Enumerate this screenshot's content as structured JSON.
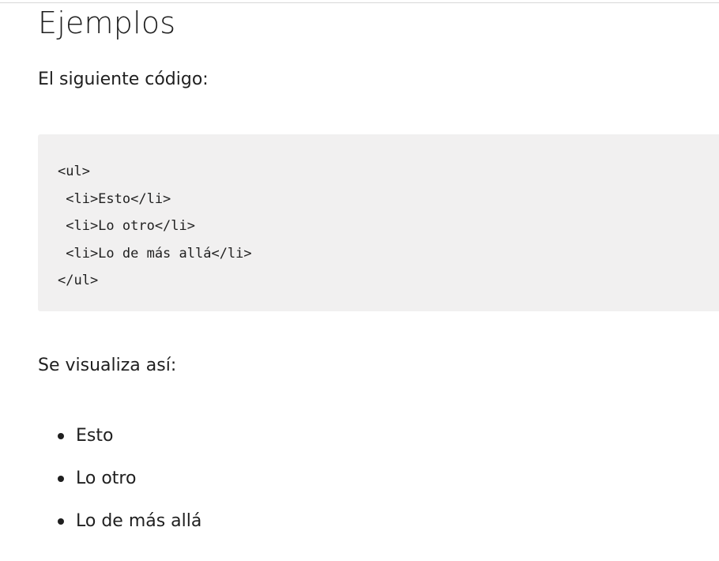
{
  "title": "Ejemplos",
  "intro_text": "El siguiente código:",
  "code_lines": [
    "<ul>",
    " <li>Esto</li>",
    " <li>Lo otro</li>",
    " <li>Lo de más allá</li>",
    "</ul>"
  ],
  "outro_text": "Se visualiza así:",
  "list_items": [
    "Esto",
    "Lo otro",
    "Lo de más allá"
  ],
  "colors": {
    "text": "#1f1f1f",
    "code_background": "#f1f0f0",
    "top_border": "#d8d8d8"
  }
}
